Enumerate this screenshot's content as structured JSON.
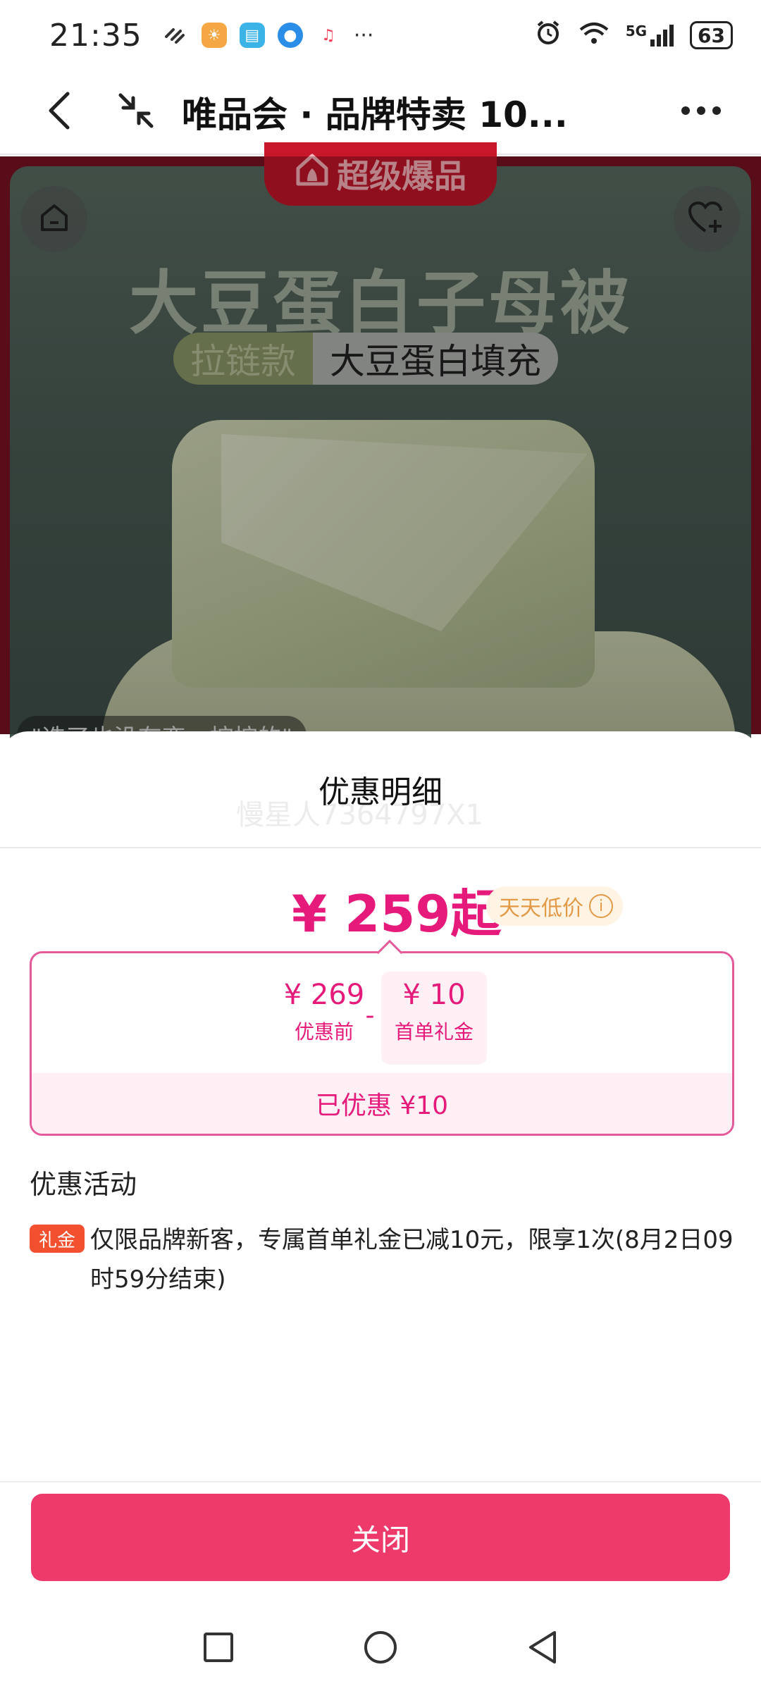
{
  "status_bar": {
    "time": "21:35",
    "network": "5G",
    "battery": "63"
  },
  "title_bar": {
    "title": "唯品会 · 品牌特卖 10..."
  },
  "product": {
    "badge": "超级爆品",
    "title": "大豆蛋白子母被",
    "tag_a": "拉链款",
    "tag_b": "大豆蛋白填充",
    "comment": "\"选了也没有变一按按的\""
  },
  "sheet": {
    "title": "优惠明细",
    "watermark": "慢星人7364797X1",
    "price": "¥ 259起",
    "price_tag": "天天低价",
    "before_amount": "¥ 269",
    "before_label": "优惠前",
    "minus": "-",
    "coupon_amount": "¥ 10",
    "coupon_label": "首单礼金",
    "saved": "已优惠 ¥10",
    "section_title": "优惠活动",
    "activity_badge": "礼金",
    "activity_text": "仅限品牌新客，专属首单礼金已减10元，限享1次(8月2日09时59分结束)",
    "close_label": "关闭"
  },
  "colors": {
    "accent": "#e61a7a",
    "button": "#ee3a6b",
    "gift_badge": "#f2502f",
    "price_tag": "#e29a46"
  }
}
